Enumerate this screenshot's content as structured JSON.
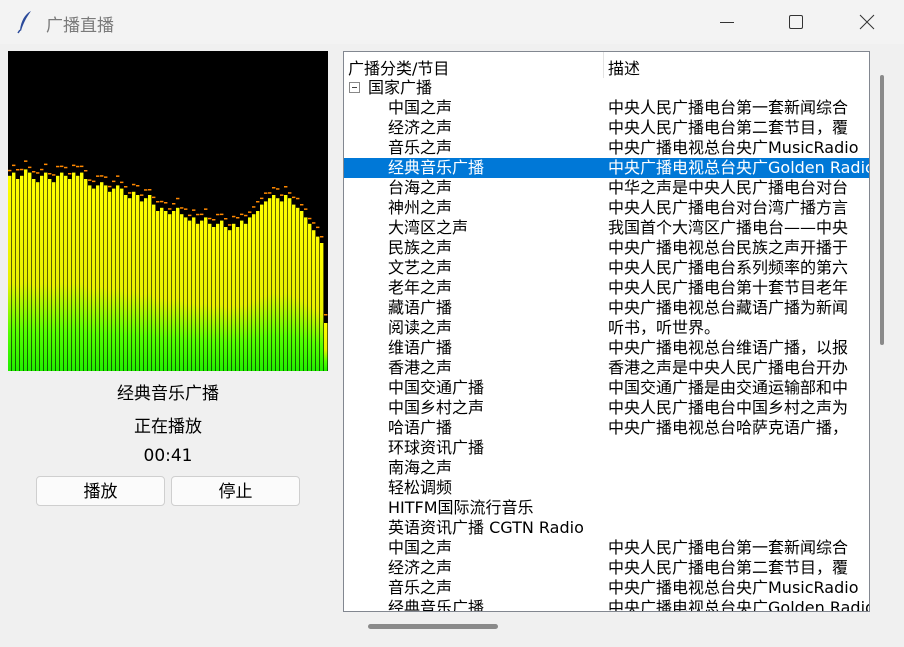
{
  "window": {
    "title": "广播直播",
    "app_icon": "feather-icon",
    "controls": [
      "minimize-icon",
      "maximize-icon",
      "close-icon"
    ]
  },
  "player": {
    "station_name": "经典音乐广播",
    "status": "正在播放",
    "elapsed": "00:41",
    "play_label": "播放",
    "stop_label": "停止",
    "spectrum_levels": [
      0.61,
      0.62,
      0.6,
      0.61,
      0.63,
      0.62,
      0.6,
      0.59,
      0.61,
      0.62,
      0.6,
      0.59,
      0.61,
      0.62,
      0.61,
      0.6,
      0.62,
      0.61,
      0.62,
      0.6,
      0.58,
      0.57,
      0.58,
      0.59,
      0.58,
      0.56,
      0.57,
      0.58,
      0.57,
      0.55,
      0.54,
      0.56,
      0.55,
      0.53,
      0.54,
      0.55,
      0.52,
      0.5,
      0.51,
      0.5,
      0.49,
      0.5,
      0.51,
      0.49,
      0.48,
      0.47,
      0.48,
      0.46,
      0.47,
      0.48,
      0.46,
      0.45,
      0.46,
      0.47,
      0.45,
      0.44,
      0.46,
      0.45,
      0.47,
      0.46,
      0.48,
      0.49,
      0.5,
      0.52,
      0.53,
      0.54,
      0.55,
      0.54,
      0.53,
      0.55,
      0.54,
      0.52,
      0.51,
      0.5,
      0.48,
      0.46,
      0.44,
      0.42,
      0.4,
      0.15
    ],
    "colors": {
      "background": "#000000",
      "top": "#ffff00",
      "bottom": "#33ff00",
      "peak": "#ff8800"
    }
  },
  "tree": {
    "headers": [
      "广播分类/节目",
      "描述"
    ],
    "rows": [
      {
        "name": "国家广播",
        "desc": "",
        "level": 0,
        "group": true
      },
      {
        "name": "中国之声",
        "desc": "中央人民广播电台第一套新闻综合",
        "level": 1
      },
      {
        "name": "经济之声",
        "desc": "中央人民广播电台第二套节目，覆",
        "level": 1
      },
      {
        "name": "音乐之声",
        "desc": "中央广播电视总台央广MusicRadio",
        "level": 1
      },
      {
        "name": "经典音乐广播",
        "desc": "中央广播电视总台央广Golden Radio",
        "level": 1,
        "selected": true
      },
      {
        "name": "台海之声",
        "desc": "中华之声是中央人民广播电台对台",
        "level": 1
      },
      {
        "name": "神州之声",
        "desc": "中央人民广播电台对台湾广播方言",
        "level": 1
      },
      {
        "name": "大湾区之声",
        "desc": "我国首个大湾区广播电台——中央",
        "level": 1
      },
      {
        "name": "民族之声",
        "desc": "中央广播电视总台民族之声开播于",
        "level": 1
      },
      {
        "name": "文艺之声",
        "desc": "中央人民广播电台系列频率的第六",
        "level": 1
      },
      {
        "name": "老年之声",
        "desc": "中央人民广播电台第十套节目老年",
        "level": 1
      },
      {
        "name": "藏语广播",
        "desc": "中央广播电视总台藏语广播为新闻",
        "level": 1
      },
      {
        "name": "阅读之声",
        "desc": "听书，听世界。",
        "level": 1
      },
      {
        "name": "维语广播",
        "desc": "中央广播电视总台维语广播，以报",
        "level": 1
      },
      {
        "name": "香港之声",
        "desc": "香港之声是中央人民广播电台开办",
        "level": 1
      },
      {
        "name": "中国交通广播",
        "desc": "中国交通广播是由交通运输部和中",
        "level": 1
      },
      {
        "name": "中国乡村之声",
        "desc": "中央人民广播电台中国乡村之声为",
        "level": 1
      },
      {
        "name": "哈语广播",
        "desc": "中央广播电视总台哈萨克语广播，",
        "level": 1
      },
      {
        "name": "环球资讯广播",
        "desc": "",
        "level": 1
      },
      {
        "name": "南海之声",
        "desc": "",
        "level": 1
      },
      {
        "name": "轻松调频",
        "desc": "",
        "level": 1
      },
      {
        "name": "HITFM国际流行音乐",
        "desc": "",
        "level": 1
      },
      {
        "name": "英语资讯广播 CGTN Radio",
        "desc": "",
        "level": 1
      },
      {
        "name": "中国之声",
        "desc": "中央人民广播电台第一套新闻综合",
        "level": 1
      },
      {
        "name": "经济之声",
        "desc": "中央人民广播电台第二套节目，覆",
        "level": 1
      },
      {
        "name": "音乐之声",
        "desc": "中央广播电视总台央广MusicRadio",
        "level": 1
      },
      {
        "name": "经典音乐广播",
        "desc": "中央广播电视总台央广Golden Radio",
        "level": 1
      }
    ]
  },
  "accent": "#0078d7"
}
